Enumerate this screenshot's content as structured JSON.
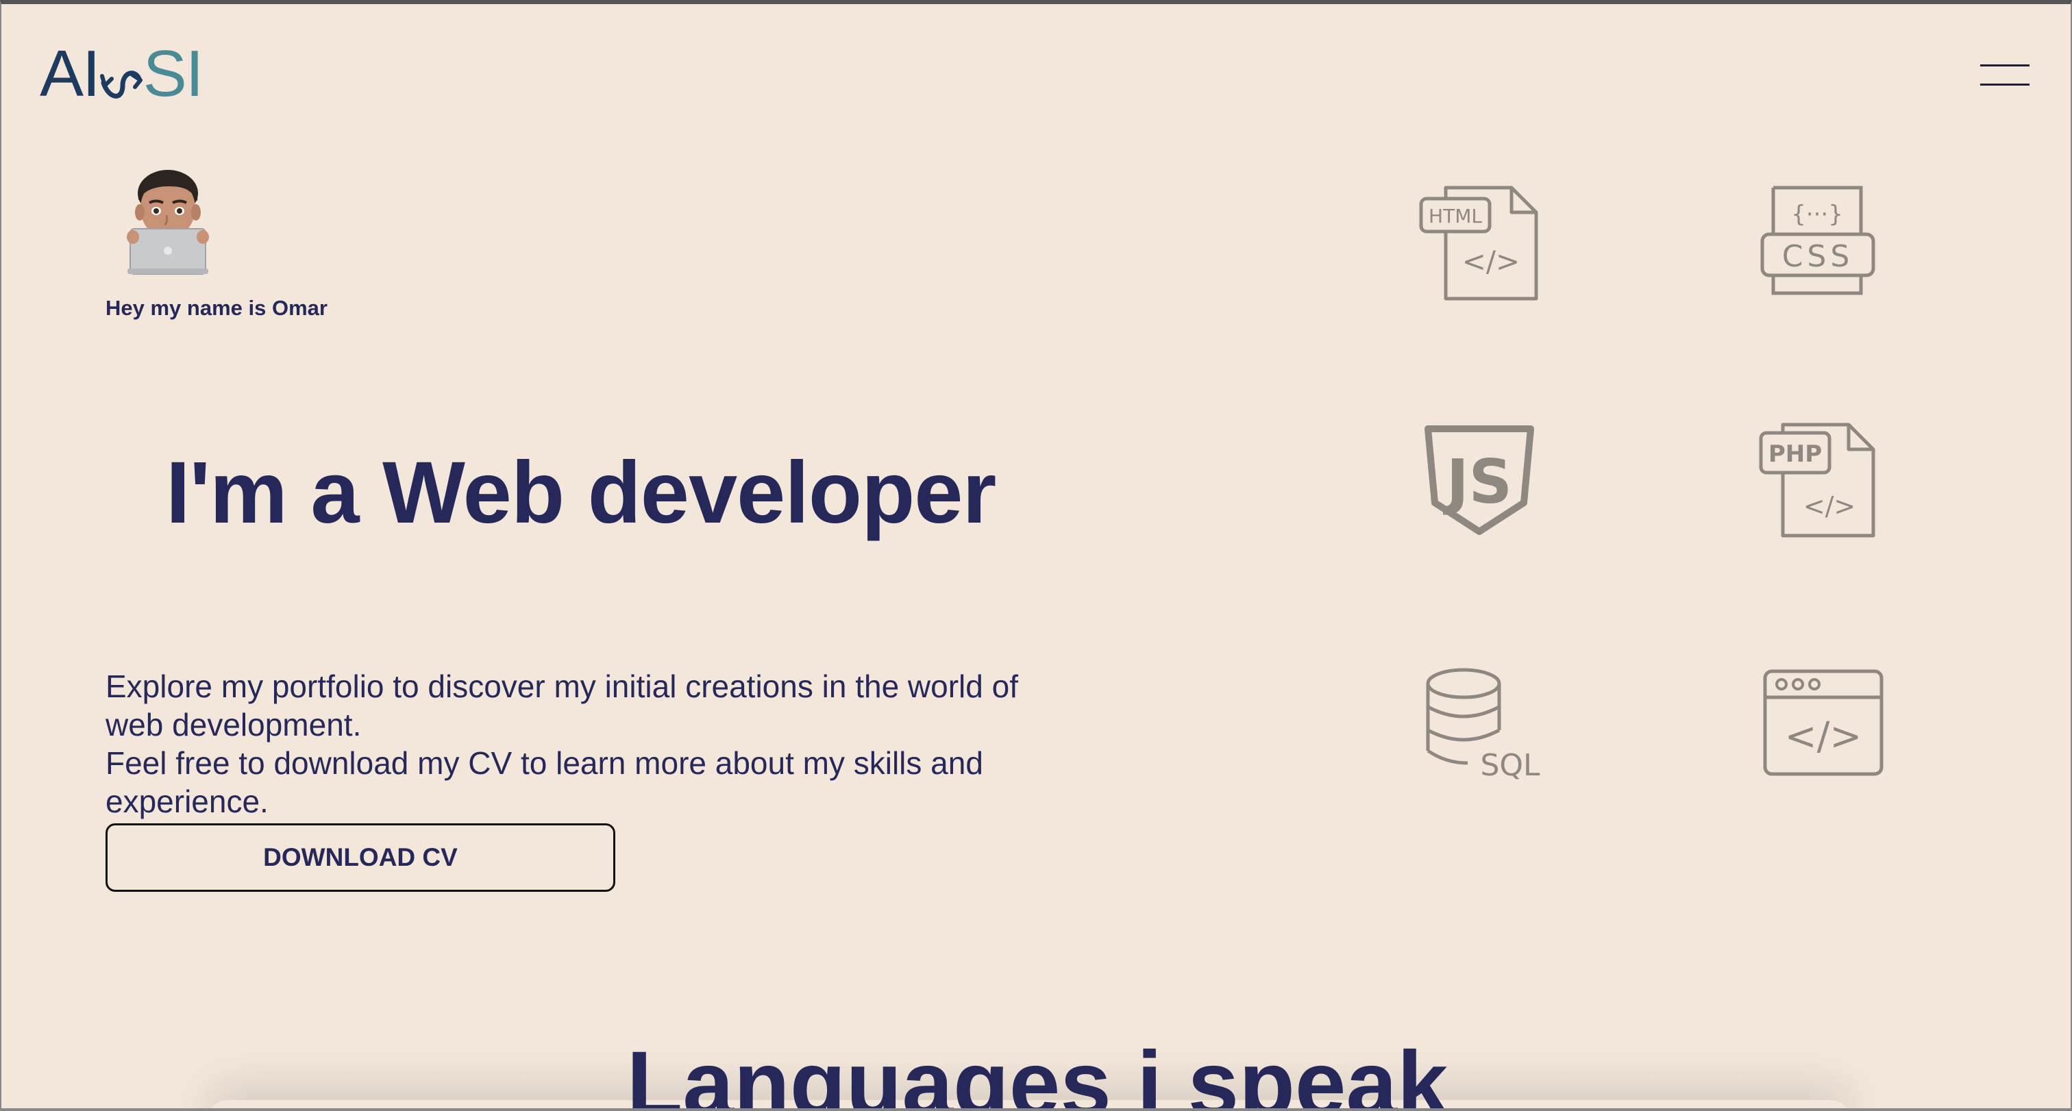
{
  "header": {
    "logo": {
      "left": "AI",
      "right": "SI"
    },
    "menu_icon": "hamburger-menu-icon"
  },
  "hero": {
    "avatar_icon": "memoji-laptop-avatar",
    "greeting": "Hey my name is Omar",
    "headline": "I'm a Web developer",
    "intro_line1": "Explore my portfolio to discover my initial creations in the world of web development.",
    "intro_line2": "Feel free to download my CV to learn more about my skills and experience.",
    "download_label": "DOWNLOAD CV"
  },
  "skills": {
    "icons": [
      {
        "name": "html-file-icon",
        "label": "HTML",
        "code": "</>"
      },
      {
        "name": "css-icon",
        "label": "CSS",
        "code": "{···}"
      },
      {
        "name": "js-shield-icon",
        "label": "JS"
      },
      {
        "name": "php-file-icon",
        "label": "PHP",
        "code": "</>"
      },
      {
        "name": "sql-database-icon",
        "label": "SQL"
      },
      {
        "name": "browser-code-icon",
        "code": "</>"
      }
    ]
  },
  "sections": {
    "languages_title": "Languages i speak"
  },
  "colors": {
    "background": "#f3e7db",
    "primary_text": "#26285a",
    "icon_gray": "#8e8880",
    "logo_dark": "#1e3a5f",
    "logo_teal": "#4a8a96"
  }
}
